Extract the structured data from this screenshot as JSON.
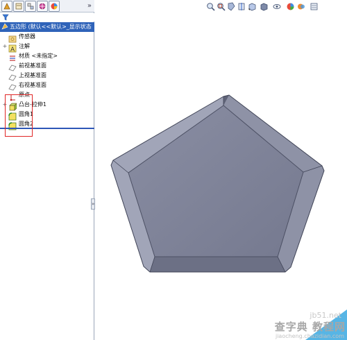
{
  "feature_tree": {
    "root_label": "五边形 (默认<<默认>_显示状态",
    "items": [
      {
        "label": "传感器",
        "icon": "sensor-folder-icon"
      },
      {
        "label": "注解",
        "icon": "annotations-icon"
      },
      {
        "label": "材质 <未指定>",
        "icon": "material-icon"
      },
      {
        "label": "前视基准面",
        "icon": "plane-icon"
      },
      {
        "label": "上视基准面",
        "icon": "plane-icon"
      },
      {
        "label": "右视基准面",
        "icon": "plane-icon"
      },
      {
        "label": "原点",
        "icon": "origin-icon"
      },
      {
        "label": "凸台-拉伸1",
        "icon": "extrude-icon"
      },
      {
        "label": "圆角1",
        "icon": "fillet-icon"
      },
      {
        "label": "圆角2",
        "icon": "fillet-icon"
      }
    ]
  },
  "panel_tabs": [
    "feature-manager-tab",
    "property-manager-tab",
    "configuration-manager-tab",
    "dimxpert-tab",
    "display-manager-tab"
  ],
  "tab_overflow": "»",
  "splitter_glyph": "»",
  "view_toolbar": [
    "zoom-fit-icon",
    "zoom-area-icon",
    "previous-view-icon",
    "section-view-icon",
    "view-orientation-icon",
    "display-style-icon",
    "hide-show-icon",
    "edit-appearance-icon",
    "apply-scene-icon",
    "view-settings-icon"
  ],
  "colors": {
    "highlight": "#2f63b9",
    "callout_box": "#e02525",
    "model_face": "#7b7f94",
    "model_edge": "#5d6176"
  },
  "watermark": {
    "site": "jb51.net",
    "cn": "查字典 教程网",
    "url": "jiaocheng.chazidian.com"
  }
}
